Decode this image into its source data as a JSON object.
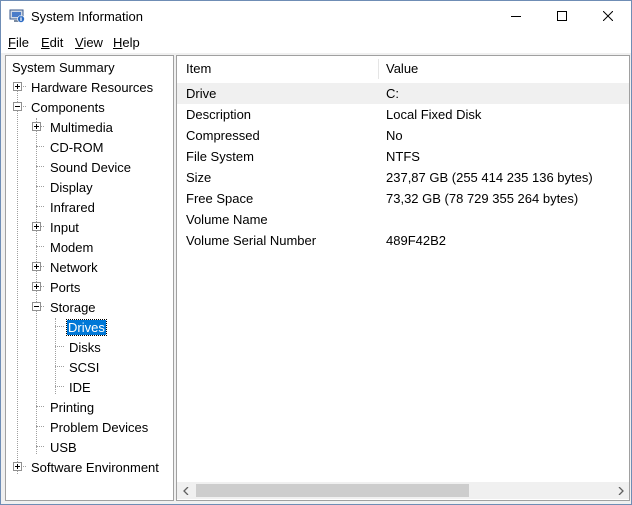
{
  "window": {
    "title": "System Information",
    "icon": "system-information-icon"
  },
  "menu": [
    {
      "accel": "F",
      "rest": "ile"
    },
    {
      "accel": "E",
      "rest": "dit"
    },
    {
      "accel": "V",
      "rest": "iew"
    },
    {
      "accel": "H",
      "rest": "elp"
    }
  ],
  "tree": {
    "root": "System Summary",
    "hardware": "Hardware Resources",
    "components": "Components",
    "multimedia": "Multimedia",
    "cdrom": "CD-ROM",
    "sound": "Sound Device",
    "display": "Display",
    "infrared": "Infrared",
    "input": "Input",
    "modem": "Modem",
    "network": "Network",
    "ports": "Ports",
    "storage": "Storage",
    "drives": "Drives",
    "disks": "Disks",
    "scsi": "SCSI",
    "ide": "IDE",
    "printing": "Printing",
    "problem": "Problem Devices",
    "usb": "USB",
    "software": "Software Environment"
  },
  "list": {
    "columns": {
      "item": "Item",
      "value": "Value"
    },
    "rows": [
      {
        "item": "Drive",
        "value": "C:"
      },
      {
        "item": "Description",
        "value": "Local Fixed Disk"
      },
      {
        "item": "Compressed",
        "value": "No"
      },
      {
        "item": "File System",
        "value": "NTFS"
      },
      {
        "item": "Size",
        "value": "237,87 GB (255 414 235 136 bytes)"
      },
      {
        "item": "Free Space",
        "value": "73,32 GB (78 729 355 264 bytes)"
      },
      {
        "item": "Volume Name",
        "value": ""
      },
      {
        "item": "Volume Serial Number",
        "value": "489F42B2"
      }
    ]
  }
}
